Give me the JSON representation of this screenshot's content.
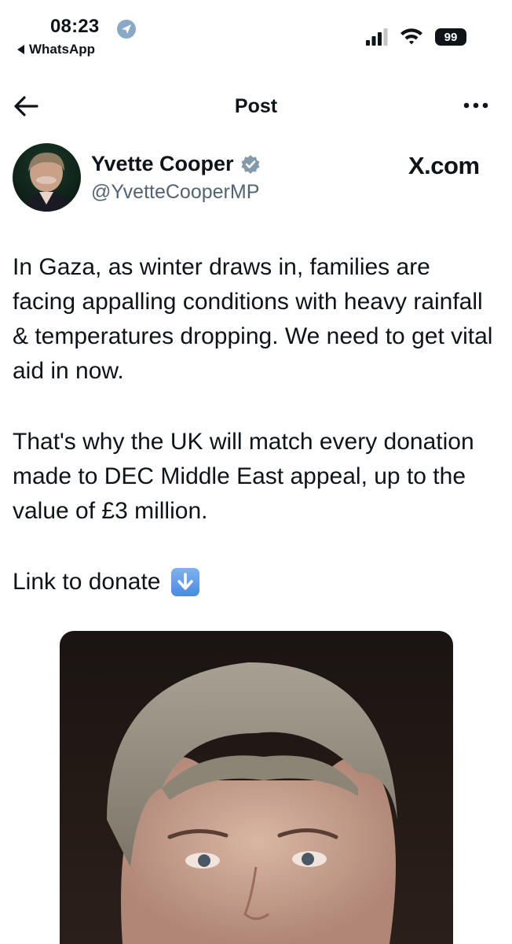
{
  "status_bar": {
    "time": "08:23",
    "back_app": "WhatsApp",
    "battery": "99"
  },
  "nav": {
    "title": "Post"
  },
  "post": {
    "author_name": "Yvette Cooper",
    "handle": "@YvetteCooperMP",
    "source": "X.com",
    "paragraphs": [
      "In Gaza, as winter draws in, families are facing appalling conditions with heavy rainfall & temperatures dropping. We need to get vital aid in now.",
      "That's why the UK will match every donation made to DEC Middle East appeal, up to the value of £3 million."
    ],
    "link_text": "Link to donate"
  },
  "colors": {
    "text": "#0f1419",
    "secondary": "#536471",
    "verified_badge": "#829aab"
  },
  "icons": [
    "location-arrow-icon",
    "cellular-signal-icon",
    "wifi-icon",
    "back-arrow-icon",
    "more-icon",
    "verified-badge-icon",
    "down-arrow-emoji"
  ]
}
